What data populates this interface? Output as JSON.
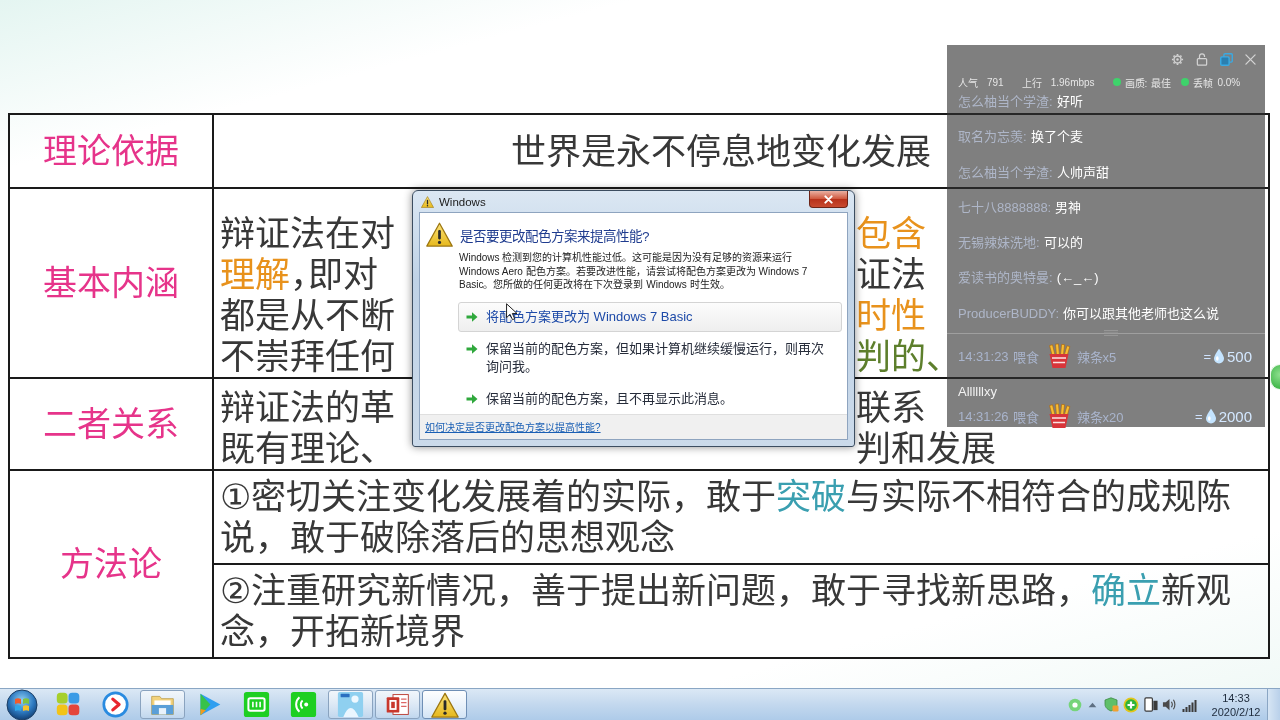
{
  "table": {
    "rows": [
      {
        "label": "理论依据",
        "cells": [
          {
            "kind": "centered",
            "segments": [
              {
                "text": "世界是永不停息地变化发展"
              }
            ]
          }
        ]
      },
      {
        "label": "基本内涵",
        "cells": [
          {
            "kind": "split",
            "lines": [
              [
                [
                  {
                    "text": "辩证法在对"
                  }
                ],
                [
                  {
                    "text": "包含",
                    "color": "#e8921c"
                  }
                ]
              ],
              [
                [
                  {
                    "text": "理解",
                    "color": "#e8921c"
                  },
                  {
                    "text": "，即对"
                  }
                ],
                [
                  {
                    "text": "证法"
                  }
                ]
              ],
              [
                [
                  {
                    "text": "都是从不断"
                  }
                ],
                [
                  {
                    "text": "时性",
                    "color": "#e8921c"
                  }
                ]
              ],
              [
                [
                  {
                    "text": "不崇拜任何"
                  }
                ],
                [
                  {
                    "text": "判的、",
                    "color": "#5d7f2c"
                  }
                ]
              ]
            ]
          }
        ]
      },
      {
        "label": "二者关系",
        "cells": [
          {
            "kind": "split",
            "lines": [
              [
                [
                  {
                    "text": "辩证法的革"
                  }
                ],
                [
                  {
                    "text": "联系"
                  }
                ]
              ],
              [
                [
                  {
                    "text": "既有理论、"
                  }
                ],
                [
                  {
                    "text": "判和发展"
                  }
                ]
              ]
            ]
          }
        ]
      },
      {
        "label": "方法论",
        "cells": [
          {
            "kind": "paragraph",
            "segments": [
              {
                "text": "①密切关注变化发展着的实际，敢于"
              },
              {
                "text": "突破",
                "color": "#3a9fb0"
              },
              {
                "text": "与实际不相符合的成规陈说，敢于破除落后的思想观念"
              }
            ]
          },
          {
            "kind": "paragraph",
            "segments": [
              {
                "text": "②注重研究新情况，善于提出新问题，敢于寻找新思路，"
              },
              {
                "text": "确立",
                "color": "#3a9fb0"
              },
              {
                "text": "新观念，开拓新境界"
              }
            ]
          }
        ]
      }
    ]
  },
  "dialog": {
    "title": "Windows",
    "heading": "是否要更改配色方案来提高性能?",
    "message": "Windows 检测到您的计算机性能过低。这可能是因为没有足够的资源来运行 Windows Aero 配色方案。若要改进性能，请尝试将配色方案更改为 Windows 7 Basic。您所做的任何更改将在下次登录到 Windows 时生效。",
    "options": [
      {
        "label": "将配色方案更改为 Windows 7 Basic",
        "selected": true
      },
      {
        "label": "保留当前的配色方案，但如果计算机继续缓慢运行，则再次询问我。",
        "selected": false
      },
      {
        "label": "保留当前的配色方案，且不再显示此消息。",
        "selected": false
      }
    ],
    "help_link": "如何决定是否更改配色方案以提高性能?"
  },
  "live_panel": {
    "stats": [
      {
        "label": "人气",
        "value": "791"
      },
      {
        "label": "上行",
        "value": "1.96mbps"
      },
      {
        "label": "画质:",
        "value": "最佳",
        "color": "#3ed36b"
      },
      {
        "label": "丢帧",
        "value": "0.0%",
        "color": "#3ed36b"
      }
    ],
    "messages": [
      {
        "user": "怎么柚当个学渣:",
        "text": "好听"
      },
      {
        "user": "取名为忘羡:",
        "text": "换了个麦"
      },
      {
        "user": "怎么柚当个学渣:",
        "text": "人帅声甜"
      },
      {
        "user": "七十八8888888:",
        "text": "男神"
      },
      {
        "user": "无锡辣妹洗地:",
        "text": "可以的"
      },
      {
        "user": "爱读书的奥特曼:",
        "text": "(←_←)"
      },
      {
        "user": "ProducerBUDDY:",
        "text": "你可以跟其他老师也这么说"
      }
    ],
    "gifts": [
      {
        "time": "14:31:23",
        "action": "喂食",
        "gift": "辣条x5",
        "equals": "=",
        "value": "500"
      },
      {
        "user": "Allllllxy",
        "time": "14:31:26",
        "action": "喂食",
        "gift": "辣条x20",
        "equals": "=",
        "value": "2000"
      }
    ]
  },
  "taskbar": {
    "apps": [
      {
        "kind": "squares",
        "running": false,
        "selected": false
      },
      {
        "kind": "disc",
        "running": false,
        "selected": false
      },
      {
        "kind": "folder",
        "running": true,
        "selected": false
      },
      {
        "kind": "play",
        "running": false,
        "selected": false
      },
      {
        "kind": "tile",
        "running": false,
        "selected": false
      },
      {
        "kind": "waves",
        "running": false,
        "selected": false
      },
      {
        "kind": "live",
        "running": true,
        "selected": false
      },
      {
        "kind": "slides",
        "running": true,
        "selected": false
      },
      {
        "kind": "warning",
        "running": true,
        "selected": true
      }
    ],
    "clock": {
      "time": "14:33",
      "date": "2020/2/12"
    }
  }
}
